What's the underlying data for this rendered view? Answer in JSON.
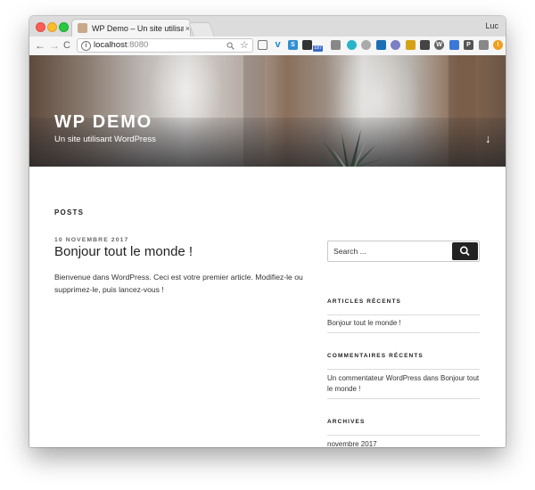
{
  "browser": {
    "tab_title": "WP Demo – Un site utilisant W",
    "tab_close": "×",
    "profile_name": "Luc",
    "nav": {
      "back": "←",
      "forward": "→",
      "reload": "C"
    },
    "url_host": "localhost",
    "url_port": ":8080",
    "ext_badge": "187"
  },
  "header": {
    "site_title": "WP DEMO",
    "tagline": "Un site utilisant WordPress",
    "scroll_arrow": "↓"
  },
  "main": {
    "section_heading": "POSTS",
    "post": {
      "date": "10 NOVEMBRE 2017",
      "title": "Bonjour tout le monde !",
      "excerpt": "Bienvenue dans WordPress. Ceci est votre premier article. Modifiez-le ou supprimez-le, puis lancez-vous !"
    }
  },
  "sidebar": {
    "search_placeholder": "Search ...",
    "recent_posts_title": "ARTICLES RÉCENTS",
    "recent_posts": [
      "Bonjour tout le monde !"
    ],
    "recent_comments_title": "COMMENTAIRES RÉCENTS",
    "recent_comments": [
      "Un commentateur WordPress dans Bonjour tout le monde !"
    ],
    "archives_title": "ARCHIVES",
    "archives": [
      "novembre 2017"
    ]
  }
}
